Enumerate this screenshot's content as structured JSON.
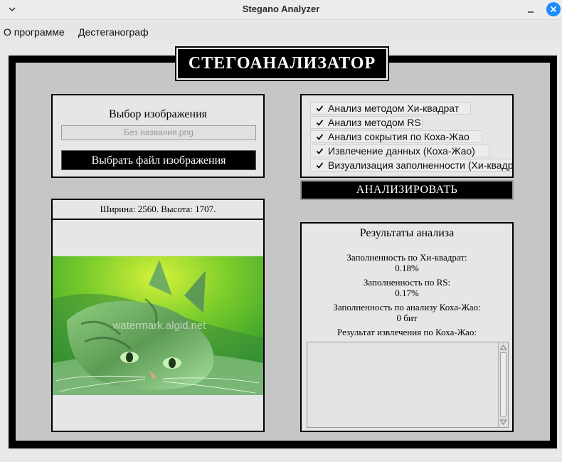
{
  "window": {
    "title": "Stegano Analyzer"
  },
  "menu": {
    "items": [
      "О программе",
      "Дестеганограф"
    ]
  },
  "app_title": "СТЕГОАНАЛИЗАТОР",
  "select_panel": {
    "header": "Выбор изображения",
    "filename_placeholder": "Без названия.png",
    "choose_button": "Выбрать файл изображения"
  },
  "checks": [
    {
      "label": "Анализ методом Хи-квадрат",
      "checked": true
    },
    {
      "label": "Анализ методом RS",
      "checked": true
    },
    {
      "label": "Анализ сокрытия по Коха-Жао",
      "checked": true
    },
    {
      "label": "Извлечение данных (Коха-Жао)",
      "checked": true
    },
    {
      "label": "Визуализация заполненности (Хи-квадрат)",
      "checked": true
    }
  ],
  "analyze_button": "АНАЛИЗИРОВАТЬ",
  "image_panel": {
    "dimensions": "Ширина: 2560. Высота: 1707.",
    "watermark": "watermark.algid.net"
  },
  "results": {
    "title": "Результаты анализа",
    "chi_label": "Заполненность по Хи-квадрат:",
    "chi_value": "0.18%",
    "rs_label": "Заполненность по RS:",
    "rs_value": "0.17%",
    "kz_label": "Заполненность по анализу Коха-Жао:",
    "kz_value": "0 бит",
    "extract_label": "Результат извлечения по Коха-Жао:",
    "extract_text": ""
  },
  "colors": {
    "accent": "#1a8cff",
    "panel": "#e6e6e6",
    "frame": "#000000",
    "workspace": "#c6c6c6"
  },
  "icons": {
    "window_menu": "chevron-down-icon",
    "minimize": "minimize-icon",
    "close": "close-icon",
    "check": "checkmark-icon",
    "scroll_up": "arrow-up-icon",
    "scroll_down": "arrow-down-icon"
  }
}
